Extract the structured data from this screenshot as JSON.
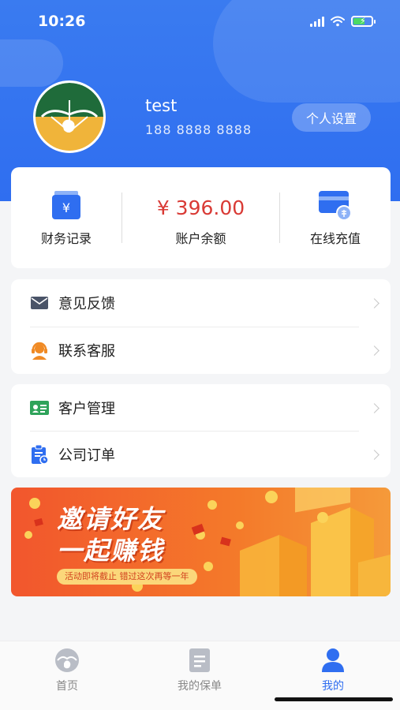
{
  "status_bar": {
    "time": "10:26"
  },
  "profile": {
    "name": "test",
    "phone": "188 8888 8888",
    "settings_label": "个人设置"
  },
  "finance": {
    "records_label": "财务记录",
    "balance_value": "¥ 396.00",
    "balance_label": "账户余额",
    "recharge_label": "在线充值"
  },
  "menu_group_1": [
    {
      "label": "意见反馈",
      "icon": "mail-icon"
    },
    {
      "label": "联系客服",
      "icon": "customer-service-icon"
    }
  ],
  "menu_group_2": [
    {
      "label": "客户管理",
      "icon": "id-card-icon"
    },
    {
      "label": "公司订单",
      "icon": "order-clipboard-icon"
    }
  ],
  "banner": {
    "title_line1": "邀请好友",
    "title_line2": "一起赚钱",
    "note": "活动即将截止  错过这次再等一年"
  },
  "tabbar": {
    "active_color": "#2f6ef0",
    "items": [
      {
        "label": "首页",
        "icon": "home-logo-icon"
      },
      {
        "label": "我的保单",
        "icon": "policy-document-icon"
      },
      {
        "label": "我的",
        "icon": "user-icon",
        "active": true
      }
    ]
  },
  "colors": {
    "brand_blue": "#2f6ef0",
    "balance_red": "#d93a35",
    "banner_orange": "#f2562d"
  }
}
